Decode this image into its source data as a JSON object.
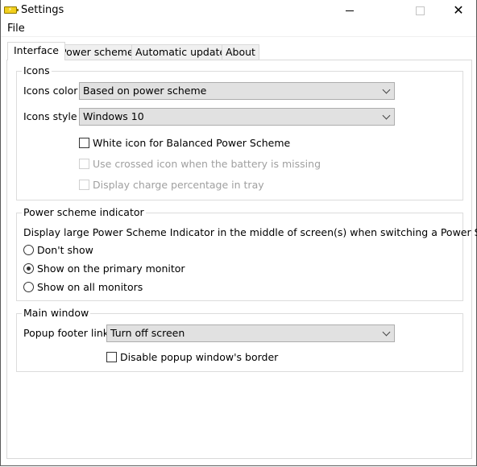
{
  "window": {
    "title": "Settings",
    "app_icon": "battery-icon",
    "controls": {
      "minimize": "minimize-icon",
      "maximize": "maximize-icon",
      "close": "close-icon"
    }
  },
  "menu": {
    "items": [
      {
        "label": "File"
      }
    ]
  },
  "tabs": [
    {
      "label": "Interface",
      "active": true
    },
    {
      "label": "Power schemes",
      "active": false
    },
    {
      "label": "Automatic updates",
      "active": false
    },
    {
      "label": "About",
      "active": false
    }
  ],
  "icons_group": {
    "legend": "Icons",
    "icons_color_label": "Icons color",
    "icons_color_value": "Based on power scheme",
    "icons_style_label": "Icons style",
    "icons_style_value": "Windows 10",
    "checkboxes": [
      {
        "label": "White icon for Balanced Power Scheme",
        "checked": false,
        "enabled": true
      },
      {
        "label": "Use crossed icon when the battery is missing",
        "checked": false,
        "enabled": false
      },
      {
        "label": "Display charge percentage in tray",
        "checked": false,
        "enabled": false
      }
    ]
  },
  "indicator_group": {
    "legend": "Power scheme indicator",
    "description": "Display large Power Scheme Indicator in the middle of screen(s) when switching a Power Scheme",
    "options": [
      {
        "label": "Don't show",
        "selected": false
      },
      {
        "label": "Show on the primary monitor",
        "selected": true
      },
      {
        "label": "Show on all monitors",
        "selected": false
      }
    ]
  },
  "main_window_group": {
    "legend": "Main window",
    "popup_footer_label": "Popup footer link",
    "popup_footer_value": "Turn off screen",
    "disable_border": {
      "label": "Disable popup window's border",
      "checked": false
    }
  }
}
